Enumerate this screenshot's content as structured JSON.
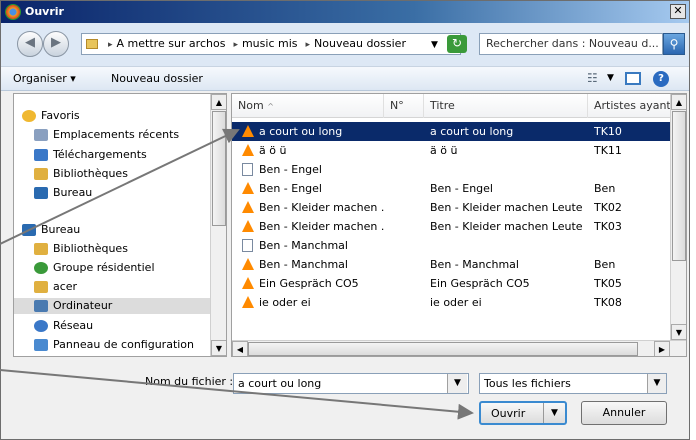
{
  "window": {
    "title": "Ouvrir",
    "close_glyph": "✕"
  },
  "address": {
    "crumbs": [
      "A mettre sur archos",
      "music mis",
      "Nouveau dossier"
    ],
    "search_placeholder": "Rechercher dans : Nouveau d...",
    "back_glyph": "◀",
    "forward_glyph": "▶"
  },
  "toolbar": {
    "organise": "Organiser ▾",
    "new_folder": "Nouveau dossier"
  },
  "nav": {
    "items": [
      {
        "label": "Favoris",
        "icon": "star-icon",
        "color": "#f0b830"
      },
      {
        "label": "Emplacements récents",
        "icon": "recent-places-icon",
        "color": "#8aa0c0"
      },
      {
        "label": "Téléchargements",
        "icon": "downloads-icon",
        "color": "#3a78c8"
      },
      {
        "label": "Bibliothèques",
        "icon": "libraries-icon",
        "color": "#e0b040"
      },
      {
        "label": "Bureau",
        "icon": "desktop-icon",
        "color": "#2a6ab0"
      },
      {
        "label": "Bureau",
        "icon": "desktop-icon",
        "color": "#2a6ab0"
      },
      {
        "label": "Bibliothèques",
        "icon": "libraries-icon",
        "color": "#e0b040"
      },
      {
        "label": "Groupe résidentiel",
        "icon": "homegroup-icon",
        "color": "#3a9a3a"
      },
      {
        "label": "acer",
        "icon": "user-folder-icon",
        "color": "#e0b040"
      },
      {
        "label": "Ordinateur",
        "icon": "computer-icon",
        "color": "#4a7ab0"
      },
      {
        "label": "Réseau",
        "icon": "network-icon",
        "color": "#3a78c8"
      },
      {
        "label": "Panneau de configuration",
        "icon": "control-panel-icon",
        "color": "#4a8ad0"
      }
    ]
  },
  "files": {
    "columns": [
      "Nom",
      "N°",
      "Titre",
      "Artistes ayant p"
    ],
    "rows": [
      {
        "name": "a court ou long",
        "num": "",
        "title": "a court ou long",
        "artist": "TK10",
        "type": "vlc",
        "selected": true
      },
      {
        "name": "ä ö ü",
        "num": "",
        "title": "ä ö ü",
        "artist": "TK11",
        "type": "vlc",
        "selected": false
      },
      {
        "name": "Ben - Engel",
        "num": "",
        "title": "",
        "artist": "",
        "type": "doc",
        "selected": false
      },
      {
        "name": "Ben - Engel",
        "num": "",
        "title": "Ben - Engel",
        "artist": "Ben",
        "type": "vlc",
        "selected": false
      },
      {
        "name": "Ben - Kleider machen ...",
        "num": "",
        "title": "Ben - Kleider machen Leute ...",
        "artist": "TK02",
        "type": "vlc",
        "selected": false
      },
      {
        "name": "Ben - Kleider machen ...",
        "num": "",
        "title": "Ben - Kleider machen Leute ...",
        "artist": "TK03",
        "type": "vlc",
        "selected": false
      },
      {
        "name": "Ben - Manchmal",
        "num": "",
        "title": "",
        "artist": "",
        "type": "doc",
        "selected": false
      },
      {
        "name": "Ben - Manchmal",
        "num": "",
        "title": "Ben - Manchmal",
        "artist": "Ben",
        "type": "vlc",
        "selected": false
      },
      {
        "name": "Ein Gespräch CO5",
        "num": "",
        "title": "Ein Gespräch CO5",
        "artist": "TK05",
        "type": "vlc",
        "selected": false
      },
      {
        "name": "ie oder ei",
        "num": "",
        "title": "ie oder ei",
        "artist": "TK08",
        "type": "vlc",
        "selected": false
      }
    ]
  },
  "bottom": {
    "filename_label": "Nom du fichier :",
    "filename_value": "a court ou long",
    "filter_value": "Tous les fichiers",
    "open_label": "Ouvrir",
    "cancel_label": "Annuler"
  }
}
